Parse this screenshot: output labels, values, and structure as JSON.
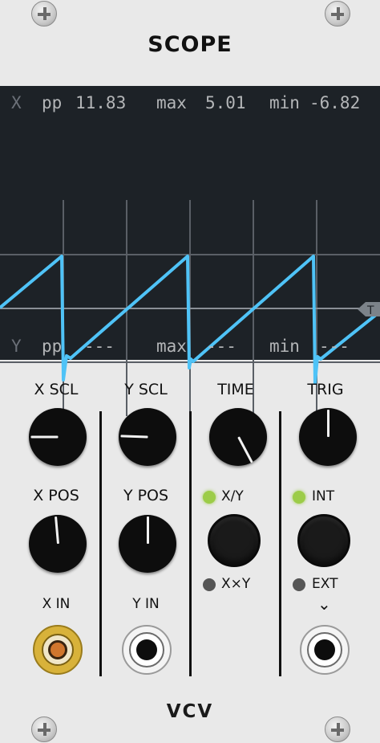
{
  "module": {
    "title": "SCOPE",
    "brand": "VCV"
  },
  "readout_x": {
    "channel": "X",
    "pp_label": "pp",
    "pp_value": "11.83",
    "max_label": "max",
    "max_value": "5.01",
    "min_label": "min",
    "min_value": "-6.82"
  },
  "readout_y": {
    "channel": "Y",
    "pp_label": "pp",
    "pp_value": "---",
    "max_label": "max",
    "max_value": "---",
    "min_label": "min",
    "min_value": "---"
  },
  "trigger_marker": "T",
  "controls": {
    "x_scl": "X SCL",
    "y_scl": "Y SCL",
    "time": "TIME",
    "trig": "TRIG",
    "x_pos": "X POS",
    "y_pos": "Y POS",
    "x_in": "X IN",
    "y_in": "Y IN"
  },
  "mode_switch": {
    "active_label": "X/Y",
    "inactive_label": "X×Y",
    "active_state": "X/Y"
  },
  "trig_switch": {
    "active_label": "INT",
    "inactive_label": "EXT",
    "active_state": "INT",
    "arrow": "⌄"
  },
  "colors": {
    "panel": "#e9e9e9",
    "display_bg": "#1d2227",
    "trace": "#4fc3f7",
    "led_on": "#9ccc48",
    "led_off": "#555555",
    "x_in_jack": "#d8b23a"
  }
}
